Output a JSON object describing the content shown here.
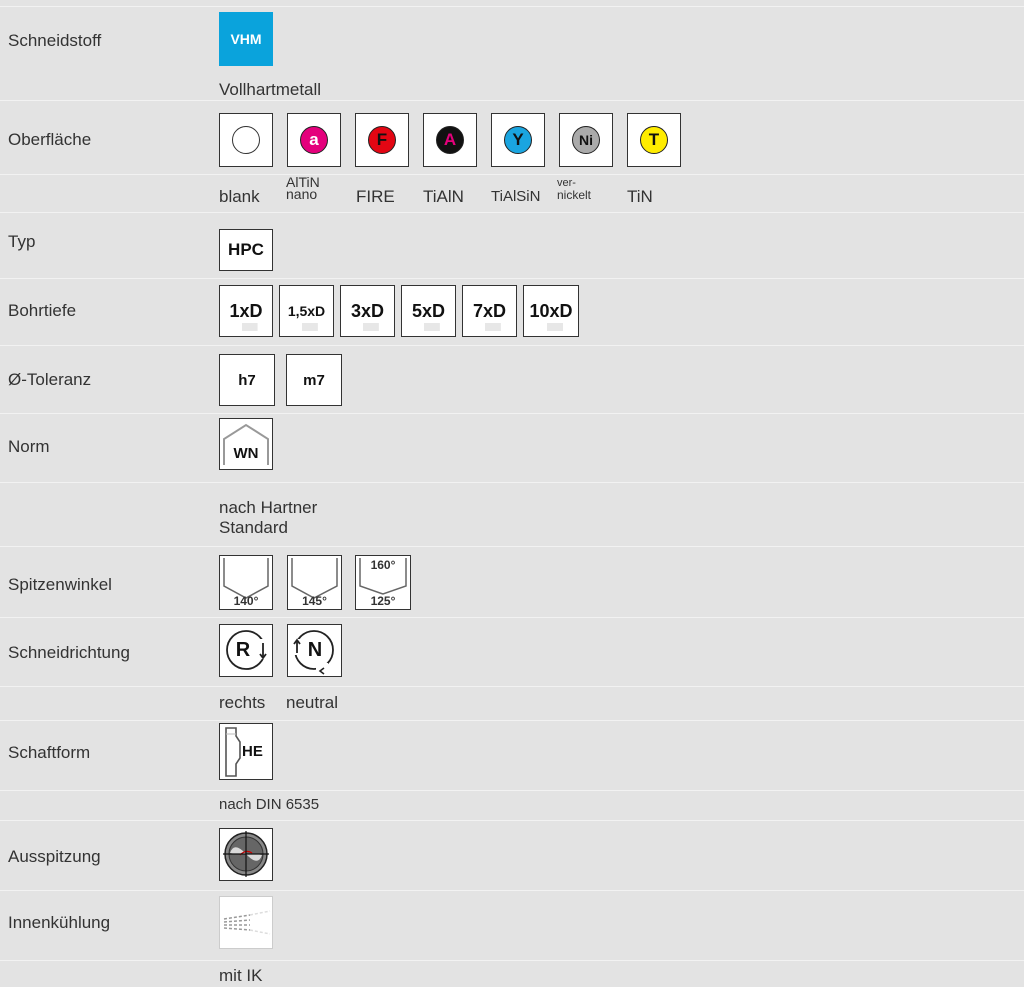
{
  "rows": {
    "schneidstoff": {
      "label": "Schneidstoff",
      "badge": "VHM",
      "sub": "Vollhartmetall"
    },
    "oberflaeche": {
      "label": "Oberfläche",
      "coatings": [
        {
          "symbol": "",
          "name": "blank",
          "color": "#ffffff"
        },
        {
          "symbol": "a",
          "name": "AlTiN nano",
          "color": "#e4007c"
        },
        {
          "symbol": "F",
          "name": "FIRE",
          "color": "#e30613"
        },
        {
          "symbol": "A",
          "name": "TiAlN",
          "color": "#111111"
        },
        {
          "symbol": "Y",
          "name": "TiAlSiN",
          "color": "#1aa5e0"
        },
        {
          "symbol": "Ni",
          "name": "vernickelt",
          "color": "#aaaaaa"
        },
        {
          "symbol": "T",
          "name": "TiN",
          "color": "#ffec00"
        }
      ],
      "label_altin_1": "AlTiN",
      "label_altin_2": "nano",
      "label_vern_1": "ver-",
      "label_vern_2": "nickelt"
    },
    "typ": {
      "label": "Typ",
      "badge": "HPC"
    },
    "bohrtiefe": {
      "label": "Bohrtiefe",
      "items": [
        "1xD",
        "1,5xD",
        "3xD",
        "5xD",
        "7xD",
        "10xD"
      ]
    },
    "toleranz": {
      "label": "Ø-Toleranz",
      "items": [
        "h7",
        "m7"
      ]
    },
    "norm": {
      "label": "Norm",
      "badge": "WN",
      "sub_1": "nach Hartner",
      "sub_2": "Standard"
    },
    "spitzenwinkel": {
      "label": "Spitzenwinkel",
      "items": [
        "140°",
        "145°",
        "160°",
        "125°"
      ]
    },
    "schneidrichtung": {
      "label": "Schneidrichtung",
      "items": [
        "R",
        "N"
      ],
      "sub_1": "rechts",
      "sub_2": "neutral"
    },
    "schaftform": {
      "label": "Schaftform",
      "badge": "HE",
      "sub": "nach DIN 6535"
    },
    "ausspitzung": {
      "label": "Ausspitzung"
    },
    "innenkuehlung": {
      "label": "Innenkühlung",
      "sub": "mit IK"
    }
  },
  "colors": {
    "background": "#e3e3e3",
    "separator": "#f2f2f2",
    "accent": "#0aa3dc"
  }
}
